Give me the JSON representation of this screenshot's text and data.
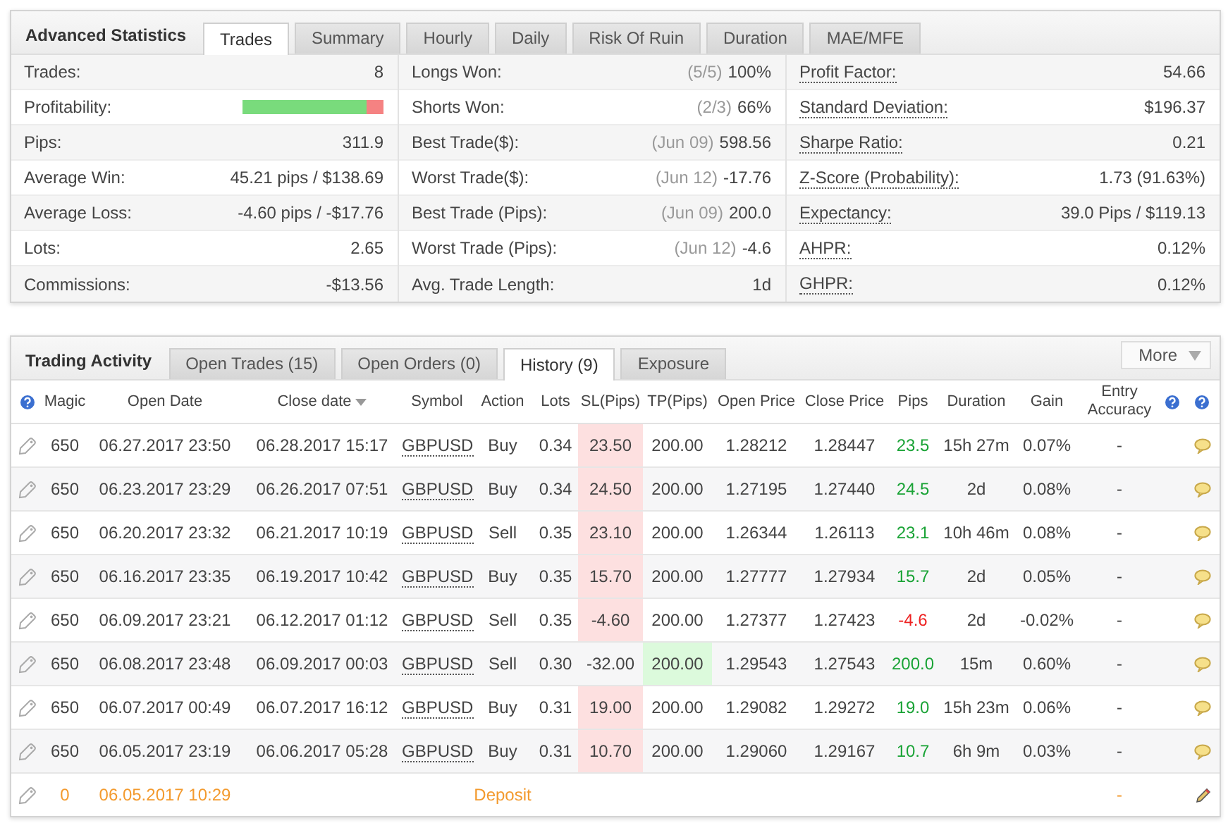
{
  "advanced_statistics": {
    "title": "Advanced Statistics",
    "tabs": [
      {
        "label": "Trades",
        "selected": true
      },
      {
        "label": "Summary",
        "selected": false
      },
      {
        "label": "Hourly",
        "selected": false
      },
      {
        "label": "Daily",
        "selected": false
      },
      {
        "label": "Risk Of Ruin",
        "selected": false
      },
      {
        "label": "Duration",
        "selected": false
      },
      {
        "label": "MAE/MFE",
        "selected": false
      }
    ],
    "columns": [
      {
        "underlined": false,
        "rows": [
          {
            "kind": "text",
            "label": "Trades:",
            "value": "8"
          },
          {
            "kind": "bar",
            "label": "Profitability:",
            "level": 0.88
          },
          {
            "kind": "text",
            "label": "Pips:",
            "value": "311.9"
          },
          {
            "kind": "text",
            "label": "Average Win:",
            "value": "45.21 pips / $138.69"
          },
          {
            "kind": "text",
            "label": "Average Loss:",
            "value": "-4.60 pips / -$17.76"
          },
          {
            "kind": "text",
            "label": "Lots:",
            "value": "2.65"
          },
          {
            "kind": "text",
            "label": "Commissions:",
            "value": "-$13.56"
          }
        ]
      },
      {
        "underlined": false,
        "rows": [
          {
            "kind": "text",
            "label": "Longs Won:",
            "note": "(5/5)",
            "value": "100%"
          },
          {
            "kind": "text",
            "label": "Shorts Won:",
            "note": "(2/3)",
            "value": "66%"
          },
          {
            "kind": "text",
            "label": "Best Trade($):",
            "note": "(Jun 09)",
            "value": "598.56"
          },
          {
            "kind": "text",
            "label": "Worst Trade($):",
            "note": "(Jun 12)",
            "value": "-17.76"
          },
          {
            "kind": "text",
            "label": "Best Trade (Pips):",
            "note": "(Jun 09)",
            "value": "200.0"
          },
          {
            "kind": "text",
            "label": "Worst Trade (Pips):",
            "note": "(Jun 12)",
            "value": "-4.6"
          },
          {
            "kind": "text",
            "label": "Avg. Trade Length:",
            "value": "1d"
          }
        ]
      },
      {
        "underlined": true,
        "rows": [
          {
            "kind": "text",
            "label": "Profit Factor:",
            "value": "54.66"
          },
          {
            "kind": "text",
            "label": "Standard Deviation:",
            "value": "$196.37"
          },
          {
            "kind": "text",
            "label": "Sharpe Ratio:",
            "value": "0.21"
          },
          {
            "kind": "text",
            "label": "Z-Score (Probability):",
            "value": "1.73 (91.63%)"
          },
          {
            "kind": "text",
            "label": "Expectancy:",
            "value": "39.0 Pips / $119.13"
          },
          {
            "kind": "text",
            "label": "AHPR:",
            "value": "0.12%"
          },
          {
            "kind": "text",
            "label": "GHPR:",
            "value": "0.12%"
          }
        ]
      }
    ]
  },
  "trading_activity": {
    "title": "Trading Activity",
    "tabs": [
      {
        "label": "Open Trades (15)",
        "selected": false
      },
      {
        "label": "Open Orders (0)",
        "selected": false
      },
      {
        "label": "History (9)",
        "selected": true
      },
      {
        "label": "Exposure",
        "selected": false
      }
    ],
    "more_button": "More",
    "columns": [
      {
        "label": "Magic",
        "sorted": false
      },
      {
        "label": "Open Date",
        "sorted": false
      },
      {
        "label": "Close date",
        "sorted": true
      },
      {
        "label": "Symbol",
        "sorted": false
      },
      {
        "label": "Action",
        "sorted": false
      },
      {
        "label": "Lots",
        "sorted": false
      },
      {
        "label": "SL(Pips)",
        "sorted": false
      },
      {
        "label": "TP(Pips)",
        "sorted": false
      },
      {
        "label": "Open Price",
        "sorted": false
      },
      {
        "label": "Close Price",
        "sorted": false
      },
      {
        "label": "Pips",
        "sorted": false
      },
      {
        "label": "Duration",
        "sorted": false
      },
      {
        "label": "Gain",
        "sorted": false
      },
      {
        "label": "Entry Accuracy",
        "sorted": false
      }
    ],
    "rows": [
      {
        "kind": "trade",
        "magic": "650",
        "open_date": "06.27.2017 23:50",
        "close_date": "06.28.2017 15:17",
        "symbol": "GBPUSD",
        "action": "Buy",
        "lots": "0.34",
        "sl": "23.50",
        "sl_highlight": true,
        "tp": "200.00",
        "tp_highlight": false,
        "open_price": "1.28212",
        "close_price": "1.28447",
        "pips": "23.5",
        "negative": false,
        "duration": "15h 27m",
        "gain": "0.07%",
        "accuracy": "-"
      },
      {
        "kind": "trade",
        "magic": "650",
        "open_date": "06.23.2017 23:29",
        "close_date": "06.26.2017 07:51",
        "symbol": "GBPUSD",
        "action": "Buy",
        "lots": "0.34",
        "sl": "24.50",
        "sl_highlight": true,
        "tp": "200.00",
        "tp_highlight": false,
        "open_price": "1.27195",
        "close_price": "1.27440",
        "pips": "24.5",
        "negative": false,
        "duration": "2d",
        "gain": "0.08%",
        "accuracy": "-"
      },
      {
        "kind": "trade",
        "magic": "650",
        "open_date": "06.20.2017 23:32",
        "close_date": "06.21.2017 10:19",
        "symbol": "GBPUSD",
        "action": "Sell",
        "lots": "0.35",
        "sl": "23.10",
        "sl_highlight": true,
        "tp": "200.00",
        "tp_highlight": false,
        "open_price": "1.26344",
        "close_price": "1.26113",
        "pips": "23.1",
        "negative": false,
        "duration": "10h 46m",
        "gain": "0.08%",
        "accuracy": "-"
      },
      {
        "kind": "trade",
        "magic": "650",
        "open_date": "06.16.2017 23:35",
        "close_date": "06.19.2017 10:42",
        "symbol": "GBPUSD",
        "action": "Buy",
        "lots": "0.35",
        "sl": "15.70",
        "sl_highlight": true,
        "tp": "200.00",
        "tp_highlight": false,
        "open_price": "1.27777",
        "close_price": "1.27934",
        "pips": "15.7",
        "negative": false,
        "duration": "2d",
        "gain": "0.05%",
        "accuracy": "-"
      },
      {
        "kind": "trade",
        "magic": "650",
        "open_date": "06.09.2017 23:21",
        "close_date": "06.12.2017 01:12",
        "symbol": "GBPUSD",
        "action": "Sell",
        "lots": "0.35",
        "sl": "-4.60",
        "sl_highlight": true,
        "tp": "200.00",
        "tp_highlight": false,
        "open_price": "1.27377",
        "close_price": "1.27423",
        "pips": "-4.6",
        "negative": true,
        "duration": "2d",
        "gain": "-0.02%",
        "accuracy": "-"
      },
      {
        "kind": "trade",
        "magic": "650",
        "open_date": "06.08.2017 23:48",
        "close_date": "06.09.2017 00:03",
        "symbol": "GBPUSD",
        "action": "Sell",
        "lots": "0.30",
        "sl": "-32.00",
        "sl_highlight": false,
        "tp": "200.00",
        "tp_highlight": true,
        "open_price": "1.29543",
        "close_price": "1.27543",
        "pips": "200.0",
        "negative": false,
        "duration": "15m",
        "gain": "0.60%",
        "accuracy": "-"
      },
      {
        "kind": "trade",
        "magic": "650",
        "open_date": "06.07.2017 00:49",
        "close_date": "06.07.2017 16:12",
        "symbol": "GBPUSD",
        "action": "Buy",
        "lots": "0.31",
        "sl": "19.00",
        "sl_highlight": true,
        "tp": "200.00",
        "tp_highlight": false,
        "open_price": "1.29082",
        "close_price": "1.29272",
        "pips": "19.0",
        "negative": false,
        "duration": "15h 23m",
        "gain": "0.06%",
        "accuracy": "-"
      },
      {
        "kind": "trade",
        "magic": "650",
        "open_date": "06.05.2017 23:19",
        "close_date": "06.06.2017 05:28",
        "symbol": "GBPUSD",
        "action": "Buy",
        "lots": "0.31",
        "sl": "10.70",
        "sl_highlight": true,
        "tp": "200.00",
        "tp_highlight": false,
        "open_price": "1.29060",
        "close_price": "1.29167",
        "pips": "10.7",
        "negative": false,
        "duration": "6h 9m",
        "gain": "0.03%",
        "accuracy": "-"
      },
      {
        "kind": "deposit",
        "magic": "0",
        "open_date": "06.05.2017 10:29",
        "action": "Deposit",
        "accuracy": "-"
      }
    ]
  }
}
